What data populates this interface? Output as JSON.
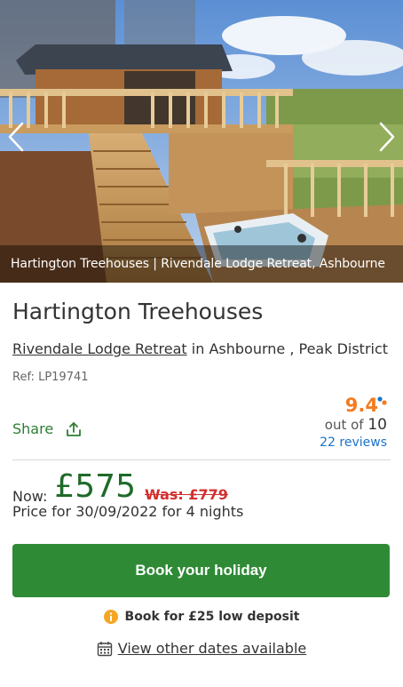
{
  "hero": {
    "caption": "Hartington Treehouses | Rivendale Lodge Retreat, Ashbourne",
    "prev_icon": "chevron-left-icon",
    "next_icon": "chevron-right-icon"
  },
  "listing": {
    "title": "Hartington Treehouses",
    "location_link": "Rivendale Lodge Retreat",
    "location_rest": " in Ashbourne , Peak District",
    "ref": "Ref: LP19741"
  },
  "share": {
    "label": "Share",
    "icon": "share-icon"
  },
  "rating": {
    "score": "9.4",
    "out_of_prefix": "out of ",
    "out_of_value": "10",
    "reviews": "22 reviews"
  },
  "pricing": {
    "now_label": "Now:",
    "price": "£575",
    "was": "Was: £779",
    "note": "Price for 30/09/2022 for 4 nights"
  },
  "actions": {
    "book_label": "Book your holiday",
    "deposit_text": "Book for £25 low deposit",
    "dates_text": "View other dates available"
  },
  "colors": {
    "primary_green": "#2f8a36",
    "price_green": "#1f6a28",
    "rating_orange": "#f47b20",
    "was_red": "#d32f2f",
    "link_blue": "#1a73c7",
    "info_amber": "#f5a623"
  }
}
